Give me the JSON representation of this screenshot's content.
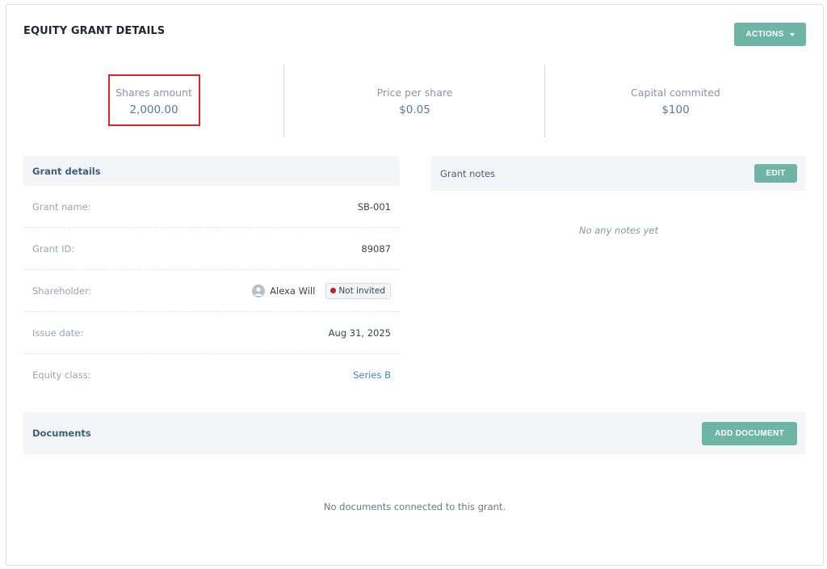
{
  "header": {
    "title": "EQUITY GRANT DETAILS",
    "actions_label": "ACTIONS"
  },
  "stats": [
    {
      "label": "Shares amount",
      "value": "2,000.00"
    },
    {
      "label": "Price per share",
      "value": "$0.05"
    },
    {
      "label": "Capital commited",
      "value": "$100"
    }
  ],
  "grant_details": {
    "title": "Grant details",
    "rows": {
      "grant_name": {
        "label": "Grant name:",
        "value": "SB-001"
      },
      "grant_id": {
        "label": "Grant ID:",
        "value": "89087"
      },
      "shareholder": {
        "label": "Shareholder:",
        "value": "Alexa Will",
        "badge": "Not invited"
      },
      "issue_date": {
        "label": "Issue date:",
        "value": "Aug 31, 2025"
      },
      "equity_class": {
        "label": "Equity class:",
        "value": "Series B"
      }
    }
  },
  "grant_notes": {
    "title": "Grant notes",
    "edit_label": "EDIT",
    "empty_text": "No any notes yet"
  },
  "documents": {
    "title": "Documents",
    "add_label": "ADD DOCUMENT",
    "empty_text": "No documents connected to this grant."
  },
  "colors": {
    "accent": "#6fb5a6",
    "link": "#3d86c6",
    "status_not_invited": "#c0202a",
    "highlight": "#d9262b"
  },
  "icons": {
    "actions_caret": "caret-down-icon",
    "avatar": "user-avatar-icon",
    "status": "status-dot-icon"
  }
}
